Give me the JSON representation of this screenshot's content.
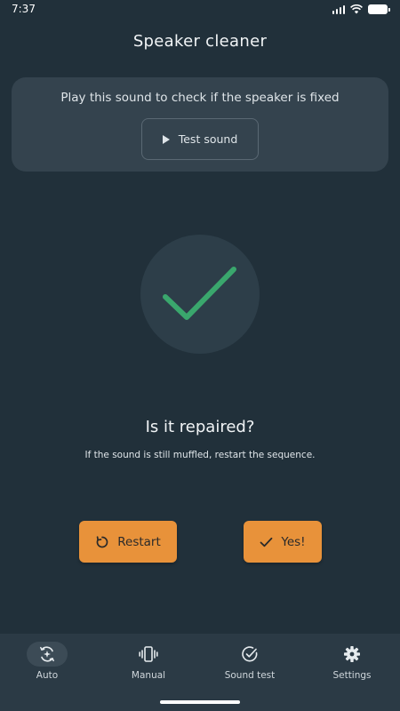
{
  "status_bar": {
    "time": "7:37"
  },
  "header": {
    "title": "Speaker cleaner"
  },
  "sound_card": {
    "text": "Play this sound to check if the speaker is fixed",
    "test_button_label": "Test sound"
  },
  "result": {
    "question": "Is it repaired?",
    "hint": "If the sound is still muffled, restart the sequence."
  },
  "actions": {
    "restart_label": "Restart",
    "yes_label": "Yes!"
  },
  "nav": {
    "items": [
      {
        "label": "Auto",
        "icon": "auto-clean-icon",
        "active": true
      },
      {
        "label": "Manual",
        "icon": "vibrate-icon",
        "active": false
      },
      {
        "label": "Sound test",
        "icon": "check-circle-icon",
        "active": false
      },
      {
        "label": "Settings",
        "icon": "gear-icon",
        "active": false
      }
    ]
  },
  "colors": {
    "background": "#21303a",
    "card": "#34434e",
    "accent": "#e8923a",
    "check": "#3aa76d",
    "nav_background": "#2b3a45"
  }
}
